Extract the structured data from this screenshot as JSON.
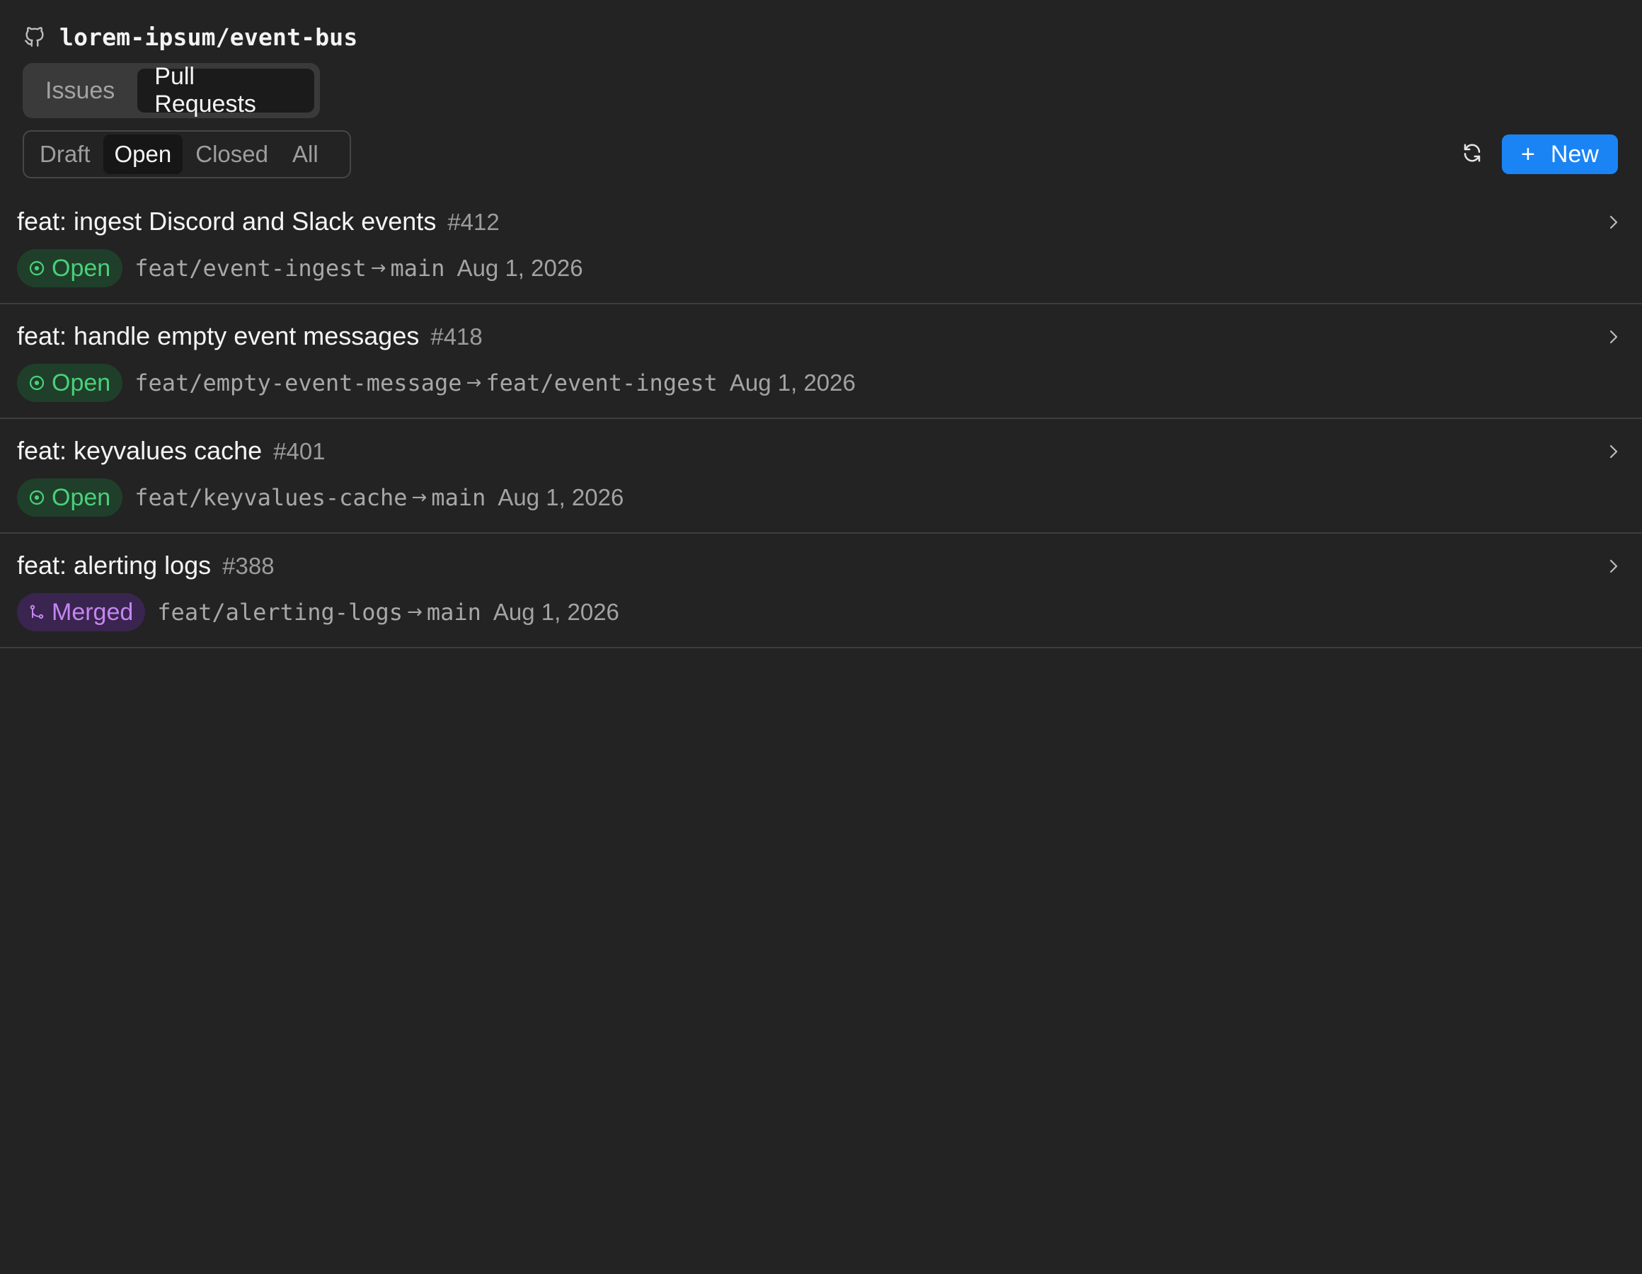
{
  "repo": {
    "name": "lorem-ipsum/event-bus",
    "icon": "github-icon"
  },
  "type_tabs": [
    {
      "label": "Issues",
      "active": false
    },
    {
      "label": "Pull Requests",
      "active": true
    }
  ],
  "filter_tabs": [
    {
      "label": "Draft",
      "active": false
    },
    {
      "label": "Open",
      "active": true
    },
    {
      "label": "Closed",
      "active": false
    },
    {
      "label": "All",
      "active": false
    }
  ],
  "toolbar": {
    "refresh_icon": "refresh-icon",
    "new_label": "New",
    "new_icon": "plus-icon",
    "new_button_color": "#1a84f5"
  },
  "pull_requests": [
    {
      "title": "feat: ingest Discord and Slack events",
      "number": "#412",
      "status": "Open",
      "status_icon": "open-circle-icon",
      "source_branch": "feat/event-ingest",
      "target_branch": "main",
      "date": "Aug 1, 2026"
    },
    {
      "title": "feat: handle empty event messages",
      "number": "#418",
      "status": "Open",
      "status_icon": "open-circle-icon",
      "source_branch": "feat/empty-event-message",
      "target_branch": "feat/event-ingest",
      "date": "Aug 1, 2026"
    },
    {
      "title": "feat: keyvalues cache",
      "number": "#401",
      "status": "Open",
      "status_icon": "open-circle-icon",
      "source_branch": "feat/keyvalues-cache",
      "target_branch": "main",
      "date": "Aug 1, 2026"
    },
    {
      "title": "feat: alerting logs",
      "number": "#388",
      "status": "Merged",
      "status_icon": "merge-icon",
      "source_branch": "feat/alerting-logs",
      "target_branch": "main",
      "date": "Aug 1, 2026"
    }
  ],
  "branch_arrow": "→",
  "colors": {
    "background": "#232323",
    "open_badge_bg": "#1f3f2a",
    "open_badge_text": "#4ad07a",
    "merged_badge_bg": "#3a2450",
    "merged_badge_text": "#c586f0"
  }
}
